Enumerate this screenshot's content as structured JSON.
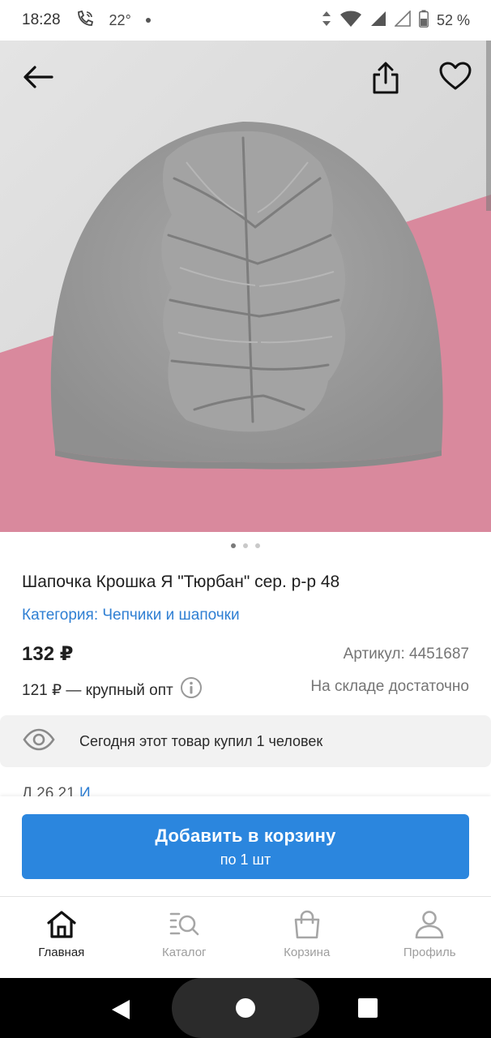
{
  "status_bar": {
    "time": "18:28",
    "temperature": "22°",
    "battery": "52 %"
  },
  "product": {
    "image_dots": 3,
    "active_image": 0,
    "title": "Шапочка Крошка Я \"Тюрбан\" сер. р-р 48",
    "category": "Категория: Чепчики и шапочки",
    "price": "132 ₽",
    "article": "Артикул: 4451687",
    "wholesale": "121 ₽ — крупный опт",
    "stock": "На складе достаточно",
    "bought_today": "Сегодня этот товар купил 1 человек",
    "clipped_text": "Д          26       21         ",
    "clipped_link": "И"
  },
  "cart_button": {
    "label": "Добавить в корзину",
    "sub_label": "по 1 шт"
  },
  "tabs": [
    {
      "label": "Главная",
      "icon": "home-icon",
      "active": true
    },
    {
      "label": "Каталог",
      "icon": "catalog-search-icon",
      "active": false
    },
    {
      "label": "Корзина",
      "icon": "shopping-bag-icon",
      "active": false
    },
    {
      "label": "Профиль",
      "icon": "profile-icon",
      "active": false
    }
  ],
  "colors": {
    "accent": "#2b86de",
    "link": "#2f7fd3",
    "background_pink": "#d9899d",
    "hat_gray": "#9b9b9b"
  }
}
